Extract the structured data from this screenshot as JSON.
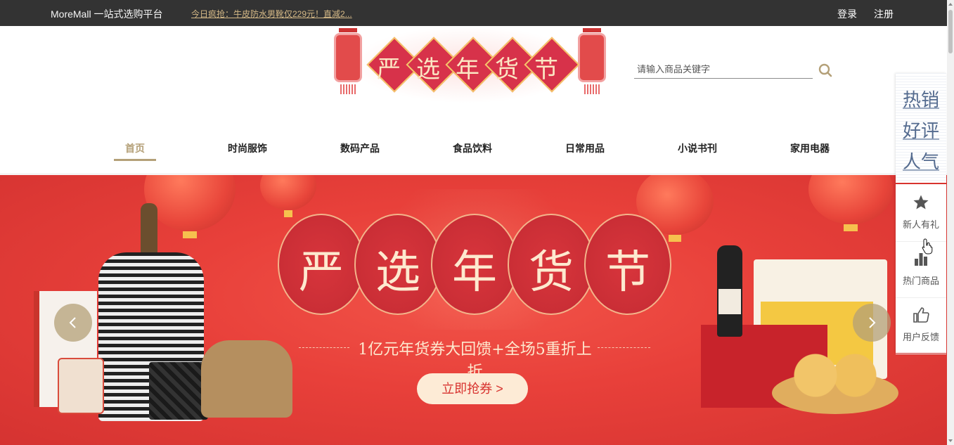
{
  "topbar": {
    "brand": "MoreMall 一站式选购平台",
    "promo": "今日疯抢：牛皮防水男靴仅229元！直减2...",
    "login": "登录",
    "register": "注册"
  },
  "logo": {
    "chars": [
      "严",
      "选",
      "年",
      "货",
      "节"
    ]
  },
  "search": {
    "placeholder": "请输入商品关键字",
    "icon": "search-icon"
  },
  "nav": {
    "items": [
      "首页",
      "时尚服饰",
      "数码产品",
      "食品饮料",
      "日常用品",
      "小说书刊",
      "家用电器"
    ],
    "active_index": 0
  },
  "banner": {
    "title_chars": [
      "严",
      "选",
      "年",
      "货",
      "节"
    ],
    "subtitle": "1亿元年货券大回馈+全场5重折上折",
    "cta": "立即抢券 >",
    "prev_icon": "chevron-left-icon",
    "next_icon": "chevron-right-icon"
  },
  "side_panel": {
    "hot_labels": [
      "热销",
      "好评",
      "人气"
    ],
    "entries": [
      {
        "label": "新人有礼",
        "icon": "star-icon"
      },
      {
        "label": "热门商品",
        "icon": "bar-chart-icon"
      },
      {
        "label": "用户反馈",
        "icon": "thumbs-up-icon"
      }
    ]
  },
  "colors": {
    "topbar_bg": "#333333",
    "accent": "#b4a078",
    "banner_red": "#e8403a",
    "cta_text": "#d8332f"
  }
}
